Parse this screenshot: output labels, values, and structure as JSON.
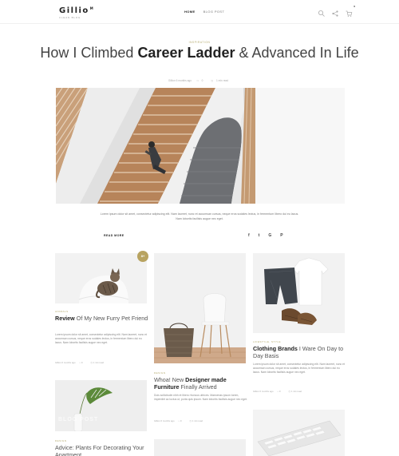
{
  "header": {
    "logo": "Gillio",
    "logo_mark": "M",
    "logo_sub": "CLEAN BLOG",
    "nav": [
      "HOME",
      "BLOG POST"
    ],
    "cart_count": "0"
  },
  "hero": {
    "category": "INSPIRATION",
    "title_pre": "How I Climbed ",
    "title_bold": "Career Ladder",
    "title_post": " & Advanced In Life",
    "meta_date": "Gillion 6 months ago",
    "meta_comments": "0",
    "meta_read": "1 min read",
    "excerpt": "Lorem ipsum dolor sit amet, consectetur adipiscing elit. Nam laoreet, nunc et accumsan cursus, neque eros sodales lectus, in fermentum libero dui eu lacus. Nam lobortis facilisis augue nec eget.",
    "read_more": "READ MORE",
    "share": [
      "f",
      "t",
      "G",
      "P"
    ]
  },
  "cards": [
    {
      "category": "ANIMALS",
      "title_pre": "",
      "title_bold": "Review",
      "title_post": " Of My New Furry Pet Friend",
      "text": "Lorem ipsum dolor sit amet, consectetur adipiscing elit. Nam laoreet, nunc et accumsan cursus, neque eros sodales lectus, in fermentum libero dui eu lacus. Nam lobortis facilisis augue nec eget.",
      "meta_date": "Gillion 6 months ago",
      "meta_comments": "0",
      "meta_read": "1 min read",
      "badge": "8+"
    },
    {
      "category": "DESIGN",
      "title_pre": "Whoa! New ",
      "title_bold": "Designer made Furniture",
      "title_post": " Finally Arrived",
      "text": "Duis sollicitudin nibh et libero rhoncus ultrices. Maecenas ipsum lorem, imperdiet ac luctus ut, porta quis ipsum. Nam lobortis facilisis augue nec eget.",
      "meta_date": "Gillion 6 months ago",
      "meta_comments": "0",
      "meta_read": "1 min read"
    },
    {
      "category": "LIFESTYLE, STYLE",
      "title_pre": "",
      "title_bold": "Clothing Brands",
      "title_post": " I Ware On Day to Day Basis",
      "text": "Lorem ipsum dolor sit amet, consectetur adipiscing elit. Nam laoreet, nunc et accumsan cursus, neque eros sodales lectus, in fermentum libero dui eu lacus. Nam lobortis facilisis augue nec eget.",
      "meta_date": "Gillion 6 months ago",
      "meta_comments": "0",
      "meta_read": "1 min read"
    },
    {
      "category": "DESIGN",
      "title_pre": "Advice: ",
      "title_bold": "",
      "title_post": "Plants For Decorating Your Apartment",
      "overlay": "BLOG POST"
    }
  ],
  "colors": {
    "accent": "#b3a86b",
    "badge": "#b8a360"
  }
}
